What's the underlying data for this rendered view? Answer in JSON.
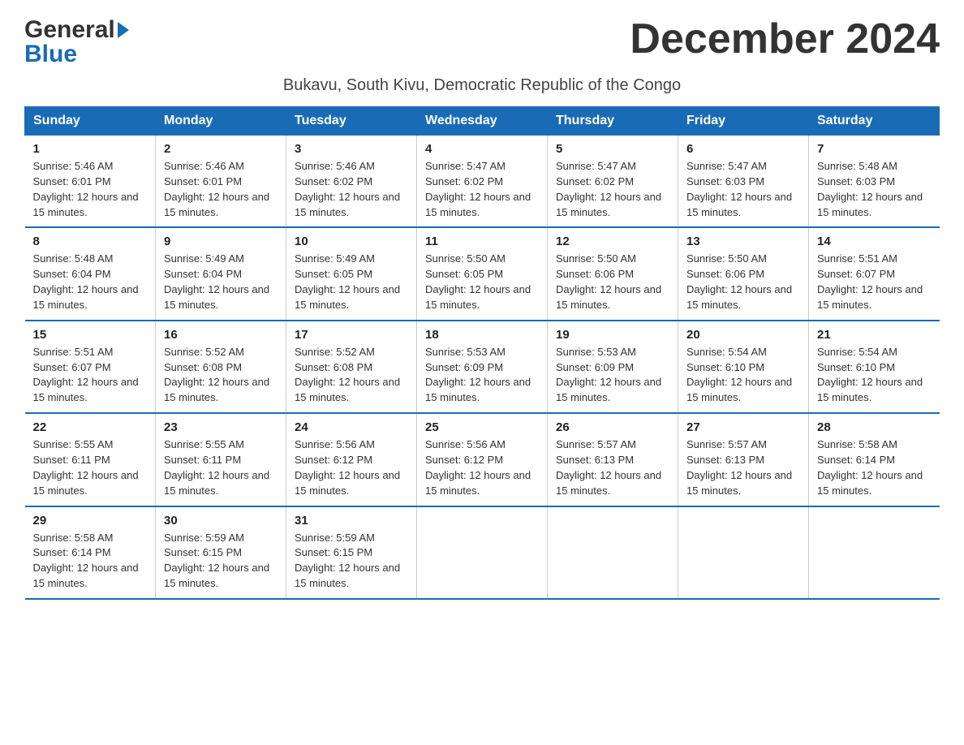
{
  "header": {
    "logo_general": "General",
    "logo_blue": "Blue",
    "month_title": "December 2024",
    "location": "Bukavu, South Kivu, Democratic Republic of the Congo"
  },
  "days_of_week": [
    "Sunday",
    "Monday",
    "Tuesday",
    "Wednesday",
    "Thursday",
    "Friday",
    "Saturday"
  ],
  "weeks": [
    [
      {
        "day": "1",
        "sunrise": "5:46 AM",
        "sunset": "6:01 PM",
        "daylight": "12 hours and 15 minutes."
      },
      {
        "day": "2",
        "sunrise": "5:46 AM",
        "sunset": "6:01 PM",
        "daylight": "12 hours and 15 minutes."
      },
      {
        "day": "3",
        "sunrise": "5:46 AM",
        "sunset": "6:02 PM",
        "daylight": "12 hours and 15 minutes."
      },
      {
        "day": "4",
        "sunrise": "5:47 AM",
        "sunset": "6:02 PM",
        "daylight": "12 hours and 15 minutes."
      },
      {
        "day": "5",
        "sunrise": "5:47 AM",
        "sunset": "6:02 PM",
        "daylight": "12 hours and 15 minutes."
      },
      {
        "day": "6",
        "sunrise": "5:47 AM",
        "sunset": "6:03 PM",
        "daylight": "12 hours and 15 minutes."
      },
      {
        "day": "7",
        "sunrise": "5:48 AM",
        "sunset": "6:03 PM",
        "daylight": "12 hours and 15 minutes."
      }
    ],
    [
      {
        "day": "8",
        "sunrise": "5:48 AM",
        "sunset": "6:04 PM",
        "daylight": "12 hours and 15 minutes."
      },
      {
        "day": "9",
        "sunrise": "5:49 AM",
        "sunset": "6:04 PM",
        "daylight": "12 hours and 15 minutes."
      },
      {
        "day": "10",
        "sunrise": "5:49 AM",
        "sunset": "6:05 PM",
        "daylight": "12 hours and 15 minutes."
      },
      {
        "day": "11",
        "sunrise": "5:50 AM",
        "sunset": "6:05 PM",
        "daylight": "12 hours and 15 minutes."
      },
      {
        "day": "12",
        "sunrise": "5:50 AM",
        "sunset": "6:06 PM",
        "daylight": "12 hours and 15 minutes."
      },
      {
        "day": "13",
        "sunrise": "5:50 AM",
        "sunset": "6:06 PM",
        "daylight": "12 hours and 15 minutes."
      },
      {
        "day": "14",
        "sunrise": "5:51 AM",
        "sunset": "6:07 PM",
        "daylight": "12 hours and 15 minutes."
      }
    ],
    [
      {
        "day": "15",
        "sunrise": "5:51 AM",
        "sunset": "6:07 PM",
        "daylight": "12 hours and 15 minutes."
      },
      {
        "day": "16",
        "sunrise": "5:52 AM",
        "sunset": "6:08 PM",
        "daylight": "12 hours and 15 minutes."
      },
      {
        "day": "17",
        "sunrise": "5:52 AM",
        "sunset": "6:08 PM",
        "daylight": "12 hours and 15 minutes."
      },
      {
        "day": "18",
        "sunrise": "5:53 AM",
        "sunset": "6:09 PM",
        "daylight": "12 hours and 15 minutes."
      },
      {
        "day": "19",
        "sunrise": "5:53 AM",
        "sunset": "6:09 PM",
        "daylight": "12 hours and 15 minutes."
      },
      {
        "day": "20",
        "sunrise": "5:54 AM",
        "sunset": "6:10 PM",
        "daylight": "12 hours and 15 minutes."
      },
      {
        "day": "21",
        "sunrise": "5:54 AM",
        "sunset": "6:10 PM",
        "daylight": "12 hours and 15 minutes."
      }
    ],
    [
      {
        "day": "22",
        "sunrise": "5:55 AM",
        "sunset": "6:11 PM",
        "daylight": "12 hours and 15 minutes."
      },
      {
        "day": "23",
        "sunrise": "5:55 AM",
        "sunset": "6:11 PM",
        "daylight": "12 hours and 15 minutes."
      },
      {
        "day": "24",
        "sunrise": "5:56 AM",
        "sunset": "6:12 PM",
        "daylight": "12 hours and 15 minutes."
      },
      {
        "day": "25",
        "sunrise": "5:56 AM",
        "sunset": "6:12 PM",
        "daylight": "12 hours and 15 minutes."
      },
      {
        "day": "26",
        "sunrise": "5:57 AM",
        "sunset": "6:13 PM",
        "daylight": "12 hours and 15 minutes."
      },
      {
        "day": "27",
        "sunrise": "5:57 AM",
        "sunset": "6:13 PM",
        "daylight": "12 hours and 15 minutes."
      },
      {
        "day": "28",
        "sunrise": "5:58 AM",
        "sunset": "6:14 PM",
        "daylight": "12 hours and 15 minutes."
      }
    ],
    [
      {
        "day": "29",
        "sunrise": "5:58 AM",
        "sunset": "6:14 PM",
        "daylight": "12 hours and 15 minutes."
      },
      {
        "day": "30",
        "sunrise": "5:59 AM",
        "sunset": "6:15 PM",
        "daylight": "12 hours and 15 minutes."
      },
      {
        "day": "31",
        "sunrise": "5:59 AM",
        "sunset": "6:15 PM",
        "daylight": "12 hours and 15 minutes."
      },
      null,
      null,
      null,
      null
    ]
  ],
  "labels": {
    "sunrise_prefix": "Sunrise: ",
    "sunset_prefix": "Sunset: ",
    "daylight_prefix": "Daylight: "
  }
}
